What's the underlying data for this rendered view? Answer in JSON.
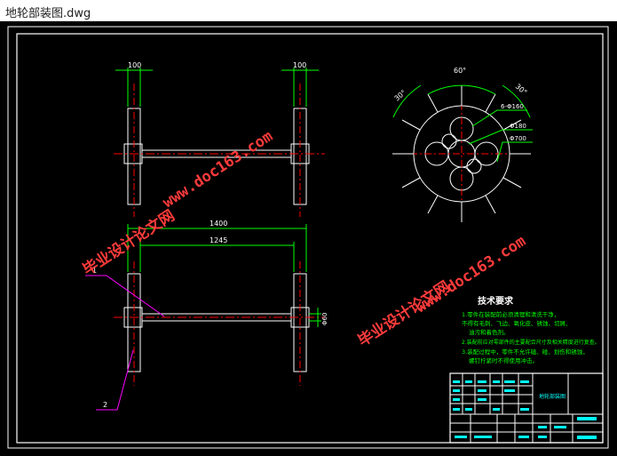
{
  "window": {
    "title": "地轮部装图.dwg"
  },
  "dims": {
    "left_top_width": "100",
    "right_top_width": "100",
    "overall_length": "1400",
    "inner_length": "1245",
    "axle_dia": "Φ60",
    "angle_top": "60°",
    "angle_left": "30°",
    "angle_right": "30°",
    "hole_callout": "6-Φ160",
    "dia_180": "Φ180",
    "dia_700": "Φ700"
  },
  "balloons": {
    "one": "1",
    "two": "2"
  },
  "watermark": {
    "text_url": "www.doc163.com",
    "text_cn": "毕业设计论文网"
  },
  "tech_requirements": {
    "title": "技术要求",
    "lines": [
      "1.零件在装配前必须清理和清洗干净，",
      "不得有毛刺、飞边、氧化皮、锈蚀、切屑、",
      "油污和着色剂。",
      "2.装配前应对零部件的主要配合尺寸及相关精度进行复查。",
      "3.装配过程中，零件不允许磕、碰、划伤和锈蚀，",
      "螺钉拧紧时不得使用冲击。"
    ]
  },
  "title_block": {
    "name": "地轮部装图"
  },
  "colors": {
    "drawing_bg": "#000000",
    "line_white": "#ffffff",
    "line_green": "#00ff00",
    "line_cyan": "#00ffff",
    "line_red": "#ff0000",
    "line_magenta": "#ff00ff",
    "watermark": "#ff3b3b"
  }
}
